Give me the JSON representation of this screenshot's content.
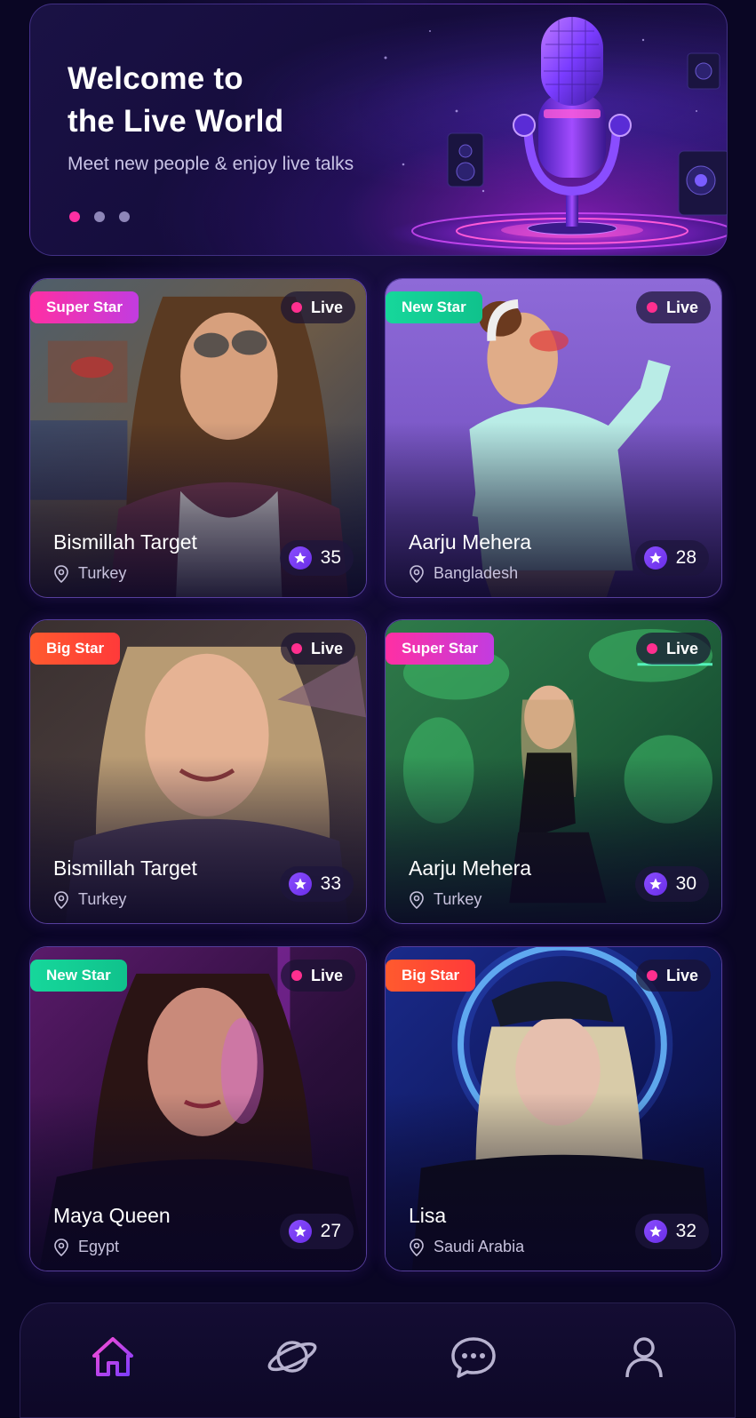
{
  "hero": {
    "title_line1": "Welcome to",
    "title_line2": "the Live World",
    "subtitle": "Meet new people & enjoy live talks",
    "pagination": {
      "total": 3,
      "active": 1
    }
  },
  "live_label": "Live",
  "cards": [
    {
      "badge": "Super Star",
      "badge_type": "super",
      "name": "Bismillah Target",
      "location": "Turkey",
      "rating": "35"
    },
    {
      "badge": "New Star",
      "badge_type": "new",
      "name": "Aarju Mehera",
      "location": "Bangladesh",
      "rating": "28"
    },
    {
      "badge": "Big Star",
      "badge_type": "big",
      "name": "Bismillah Target",
      "location": "Turkey",
      "rating": "33"
    },
    {
      "badge": "Super Star",
      "badge_type": "super",
      "name": "Aarju Mehera",
      "location": "Turkey",
      "rating": "30"
    },
    {
      "badge": "New Star",
      "badge_type": "new",
      "name": "Maya Queen",
      "location": "Egypt",
      "rating": "27"
    },
    {
      "badge": "Big Star",
      "badge_type": "big",
      "name": "Lisa",
      "location": "Saudi Arabia",
      "rating": "32"
    }
  ],
  "nav": {
    "items": [
      {
        "icon": "home-icon",
        "active": true
      },
      {
        "icon": "planet-icon",
        "active": false
      },
      {
        "icon": "chat-icon",
        "active": false
      },
      {
        "icon": "profile-icon",
        "active": false
      }
    ]
  },
  "colors": {
    "background": "#0a0624",
    "accent_pink": "#ff2fa3",
    "accent_purple": "#7a3cff",
    "badge_new": "#16d79b",
    "badge_big": "#ff4a2e"
  }
}
